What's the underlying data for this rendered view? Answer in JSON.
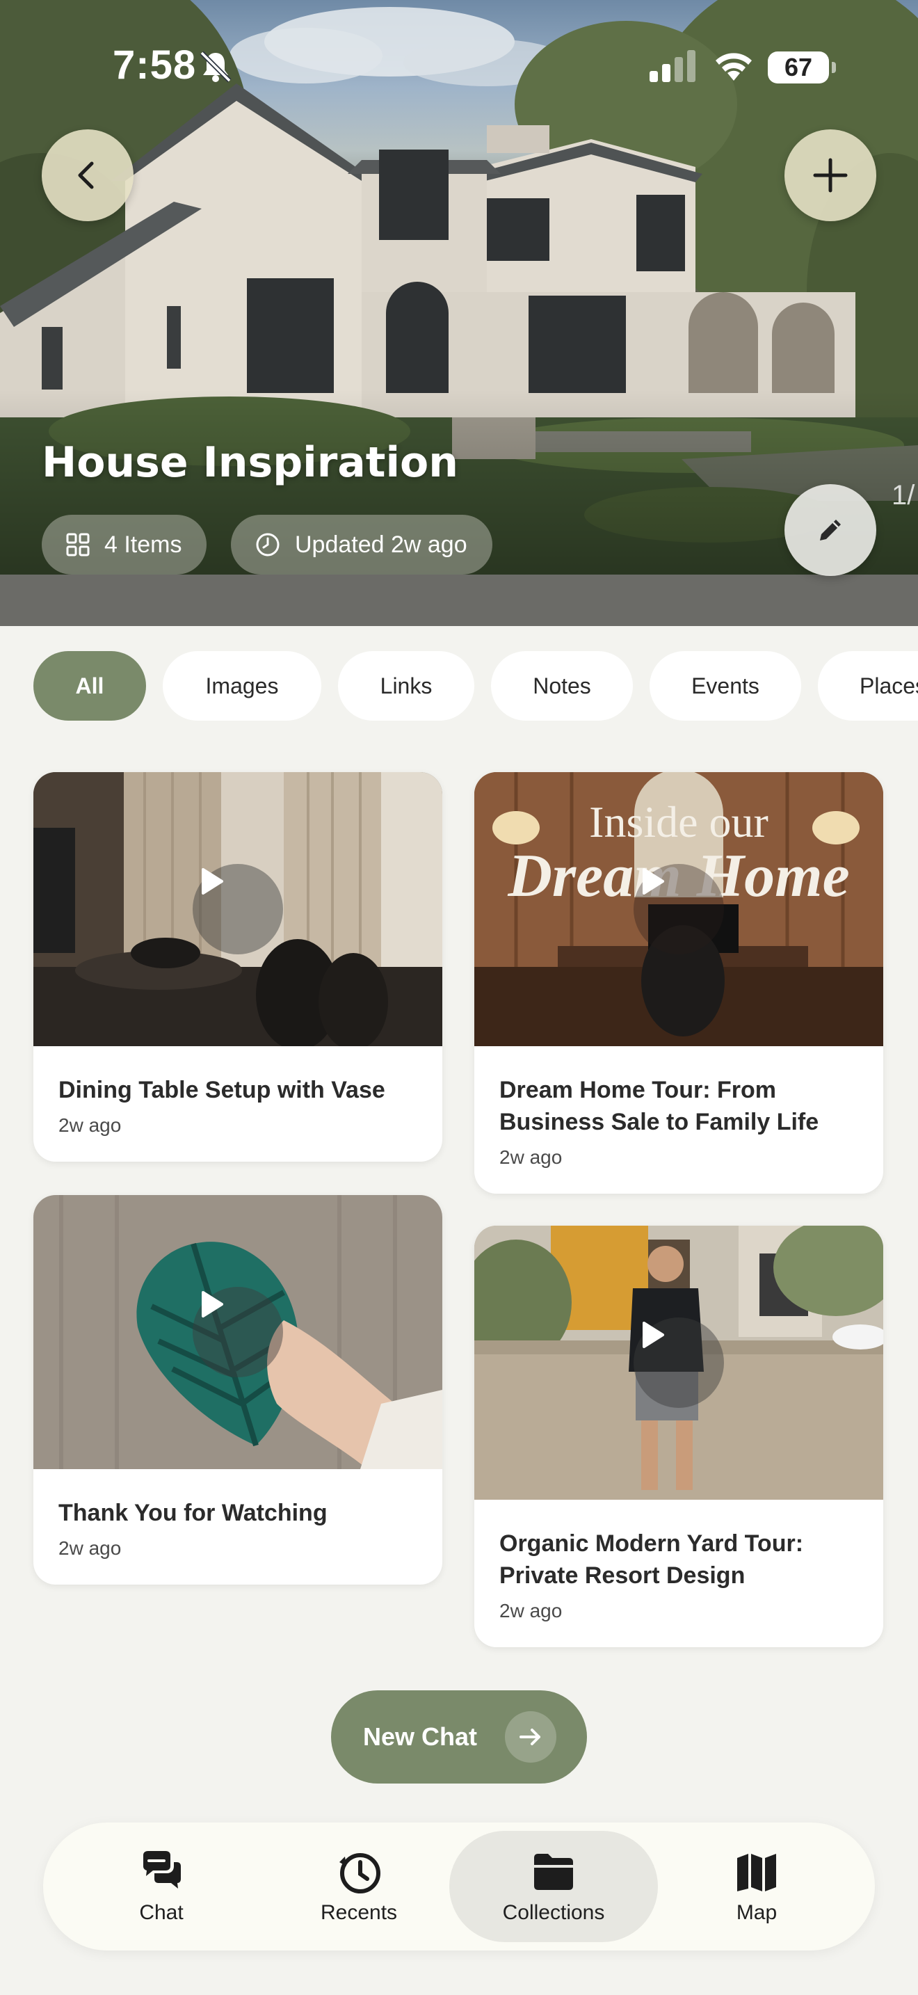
{
  "status_bar": {
    "time": "7:58",
    "battery": "67"
  },
  "hero": {
    "title": "House Inspiration",
    "items_chip": "4 Items",
    "updated_chip": "Updated 2w ago",
    "page_indicator": "1/"
  },
  "filters": [
    {
      "label": "All",
      "active": true
    },
    {
      "label": "Images",
      "active": false
    },
    {
      "label": "Links",
      "active": false
    },
    {
      "label": "Notes",
      "active": false
    },
    {
      "label": "Events",
      "active": false
    },
    {
      "label": "Places",
      "active": false
    }
  ],
  "cards": [
    {
      "title": "Dining Table Setup with Vase",
      "time": "2w ago"
    },
    {
      "title": "Dream Home Tour: From Business Sale to Family Life",
      "time": "2w ago",
      "thumb_overlay_line1": "Inside our",
      "thumb_overlay_line2": "Dream Home"
    },
    {
      "title": "Thank You for Watching",
      "time": "2w ago"
    },
    {
      "title": "Organic Modern Yard Tour: Private Resort Design",
      "time": "2w ago"
    }
  ],
  "new_chat": {
    "label": "New Chat"
  },
  "bottom_nav": [
    {
      "label": "Chat",
      "icon": "chat-bubbles-icon",
      "active": false
    },
    {
      "label": "Recents",
      "icon": "clock-history-icon",
      "active": false
    },
    {
      "label": "Collections",
      "icon": "folder-icon",
      "active": true
    },
    {
      "label": "Map",
      "icon": "map-icon",
      "active": false
    }
  ],
  "colors": {
    "accent": "#7a8a6a",
    "background": "#f3f3ef",
    "card": "#ffffff"
  }
}
